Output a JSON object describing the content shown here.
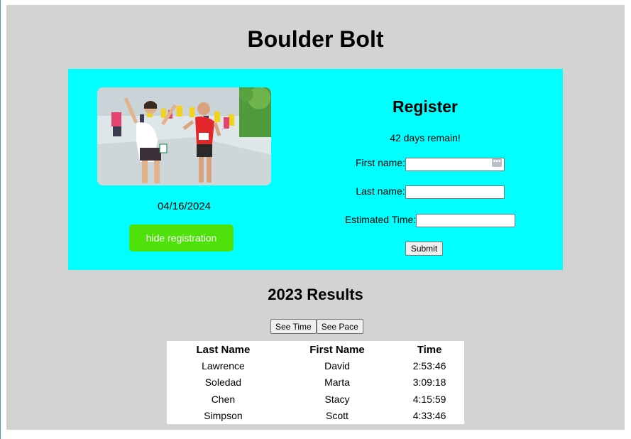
{
  "site": {
    "title": "Boulder Bolt"
  },
  "hero": {
    "date": "04/16/2024",
    "toggle_button": "hide registration"
  },
  "register": {
    "title": "Register",
    "countdown": "42 days remain!",
    "fields": {
      "first_name_label": "First name:",
      "first_name_value": "",
      "last_name_label": "Last name:",
      "last_name_value": "",
      "estimated_time_label": "Estimated Time:",
      "estimated_time_value": ""
    },
    "submit_label": "Submit"
  },
  "results": {
    "title": "2023 Results",
    "buttons": {
      "time": "See Time",
      "pace": "See Pace"
    },
    "headers": [
      "Last Name",
      "First Name",
      "Time"
    ],
    "rows": [
      [
        "Lawrence",
        "David",
        "2:53:46"
      ],
      [
        "Soledad",
        "Marta",
        "3:09:18"
      ],
      [
        "Chen",
        "Stacy",
        "4:15:59"
      ],
      [
        "Simpson",
        "Scott",
        "4:33:46"
      ]
    ]
  },
  "colors": {
    "page_bg": "#d3d3d3",
    "panel_bg": "#00ffff",
    "toggle_button_bg": "#4ee10a"
  }
}
